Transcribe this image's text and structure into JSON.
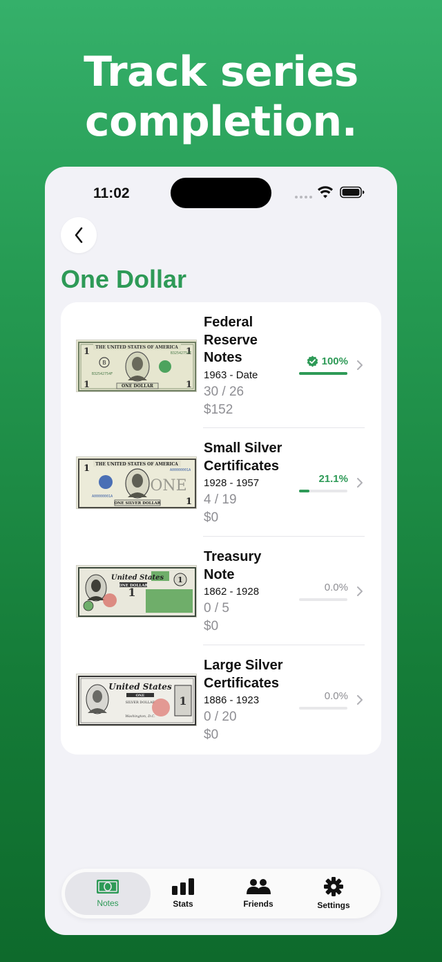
{
  "headline": {
    "line1": "Track series",
    "line2": "completion."
  },
  "status_bar": {
    "time": "11:02"
  },
  "page": {
    "title": "One Dollar"
  },
  "series": [
    {
      "name_lines": [
        "Federal",
        "Reserve",
        "Notes"
      ],
      "years": "1963 - Date",
      "count": "30 / 26",
      "value": "$152",
      "percent": "100%",
      "progress": 1.0,
      "completed": true,
      "image": "federal-reserve-note-image"
    },
    {
      "name_lines": [
        "Small Silver",
        "Certificates"
      ],
      "years": "1928 - 1957",
      "count": "4 / 19",
      "value": "$0",
      "percent": "21.1%",
      "progress": 0.211,
      "completed": false,
      "image": "small-silver-certificate-image"
    },
    {
      "name_lines": [
        "Treasury",
        "Note"
      ],
      "years": "1862 - 1928",
      "count": "0 / 5",
      "value": "$0",
      "percent": "0.0%",
      "progress": 0.0,
      "completed": false,
      "image": "treasury-note-image"
    },
    {
      "name_lines": [
        "Large Silver",
        "Certificates"
      ],
      "years": "1886 - 1923",
      "count": "0 / 20",
      "value": "$0",
      "percent": "0.0%",
      "progress": 0.0,
      "completed": false,
      "image": "large-silver-certificate-image"
    }
  ],
  "tabs": [
    {
      "label": "Notes",
      "icon": "banknote-icon",
      "active": true
    },
    {
      "label": "Stats",
      "icon": "bar-chart-icon",
      "active": false
    },
    {
      "label": "Friends",
      "icon": "people-icon",
      "active": false
    },
    {
      "label": "Settings",
      "icon": "gear-icon",
      "active": false
    }
  ],
  "colors": {
    "accent": "#2e9a57",
    "muted": "#8e8e93",
    "background": "#f2f2f7"
  }
}
